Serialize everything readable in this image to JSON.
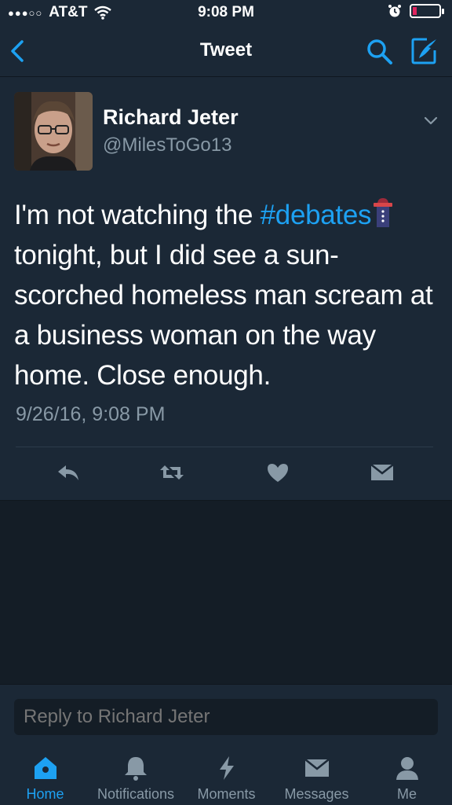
{
  "status_bar": {
    "signal": "●●●○○",
    "carrier": "AT&T",
    "time": "9:08 PM",
    "icons": [
      "wifi-icon",
      "alarm-icon",
      "battery-low-icon"
    ]
  },
  "nav": {
    "title": "Tweet",
    "icons": [
      "back-chevron-icon",
      "search-icon",
      "compose-icon"
    ]
  },
  "tweet": {
    "author_name": "Richard Jeter",
    "author_handle": "@MilesToGo13",
    "text_before": "I'm not watching the ",
    "hashtag": "#debates",
    "text_after": " tonight, but I did see a sun-scorched homeless man scream at a business woman on the way home. Close enough.",
    "timestamp": "9/26/16, 9:08 PM",
    "actions": [
      "reply-icon",
      "retweet-icon",
      "like-icon",
      "message-icon"
    ]
  },
  "reply": {
    "placeholder": "Reply to Richard Jeter"
  },
  "tabs": [
    {
      "label": "Home",
      "icon": "home-icon",
      "active": true
    },
    {
      "label": "Notifications",
      "icon": "bell-icon",
      "active": false
    },
    {
      "label": "Moments",
      "icon": "lightning-icon",
      "active": false
    },
    {
      "label": "Messages",
      "icon": "envelope-icon",
      "active": false
    },
    {
      "label": "Me",
      "icon": "person-icon",
      "active": false
    }
  ],
  "colors": {
    "accent": "#1da1f2",
    "background": "#141d26",
    "surface": "#1b2836",
    "secondary_text": "#8899a6",
    "battery_low": "#e0245e"
  }
}
